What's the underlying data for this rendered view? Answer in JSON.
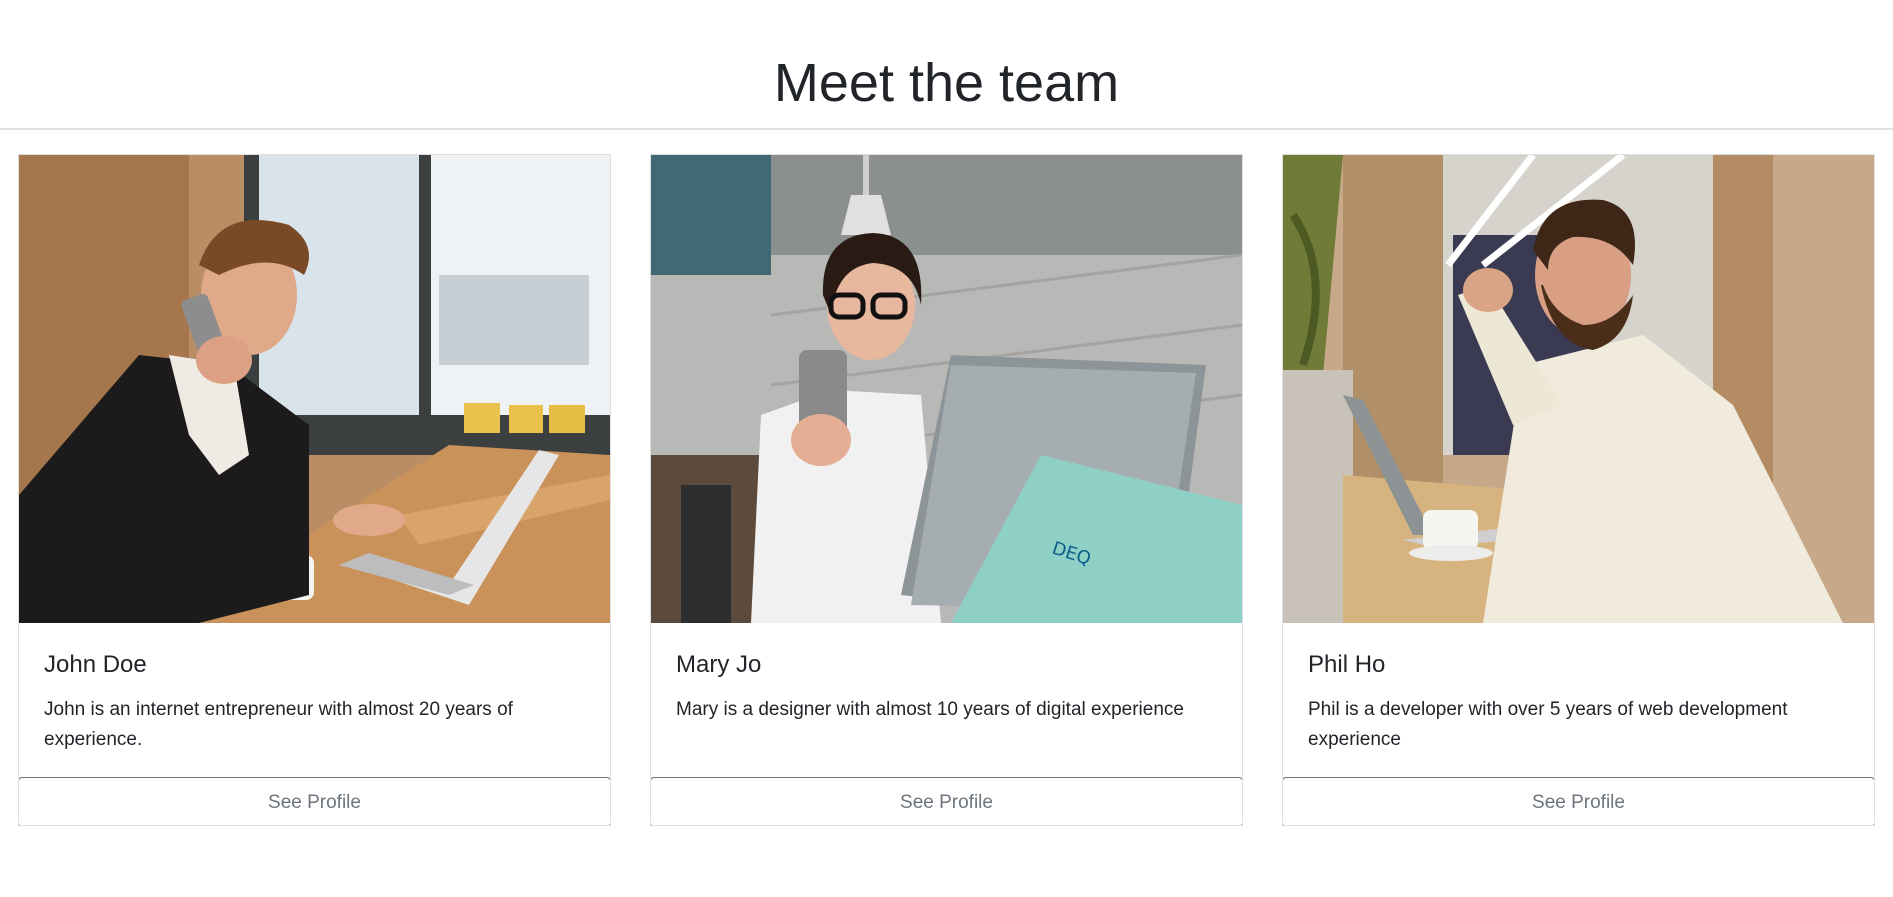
{
  "header": {
    "title": "Meet the team"
  },
  "team": [
    {
      "name": "John Doe",
      "bio": "John is an internet entrepreneur with almost 20 years of experience.",
      "button_label": "See Profile",
      "photo_icon": "man-on-phone-with-laptop-photo"
    },
    {
      "name": "Mary Jo",
      "bio": "Mary is a designer with almost 10 years of digital experience",
      "button_label": "See Profile",
      "photo_icon": "woman-with-glasses-and-laptop-photo"
    },
    {
      "name": "Phil Ho",
      "bio": "Phil is a developer with over 5 years of web development experience",
      "button_label": "See Profile",
      "photo_icon": "bearded-man-at-desk-photo"
    }
  ],
  "colors": {
    "text": "#212529",
    "border": "#dee2e6",
    "button_outline": "#6c757d"
  }
}
